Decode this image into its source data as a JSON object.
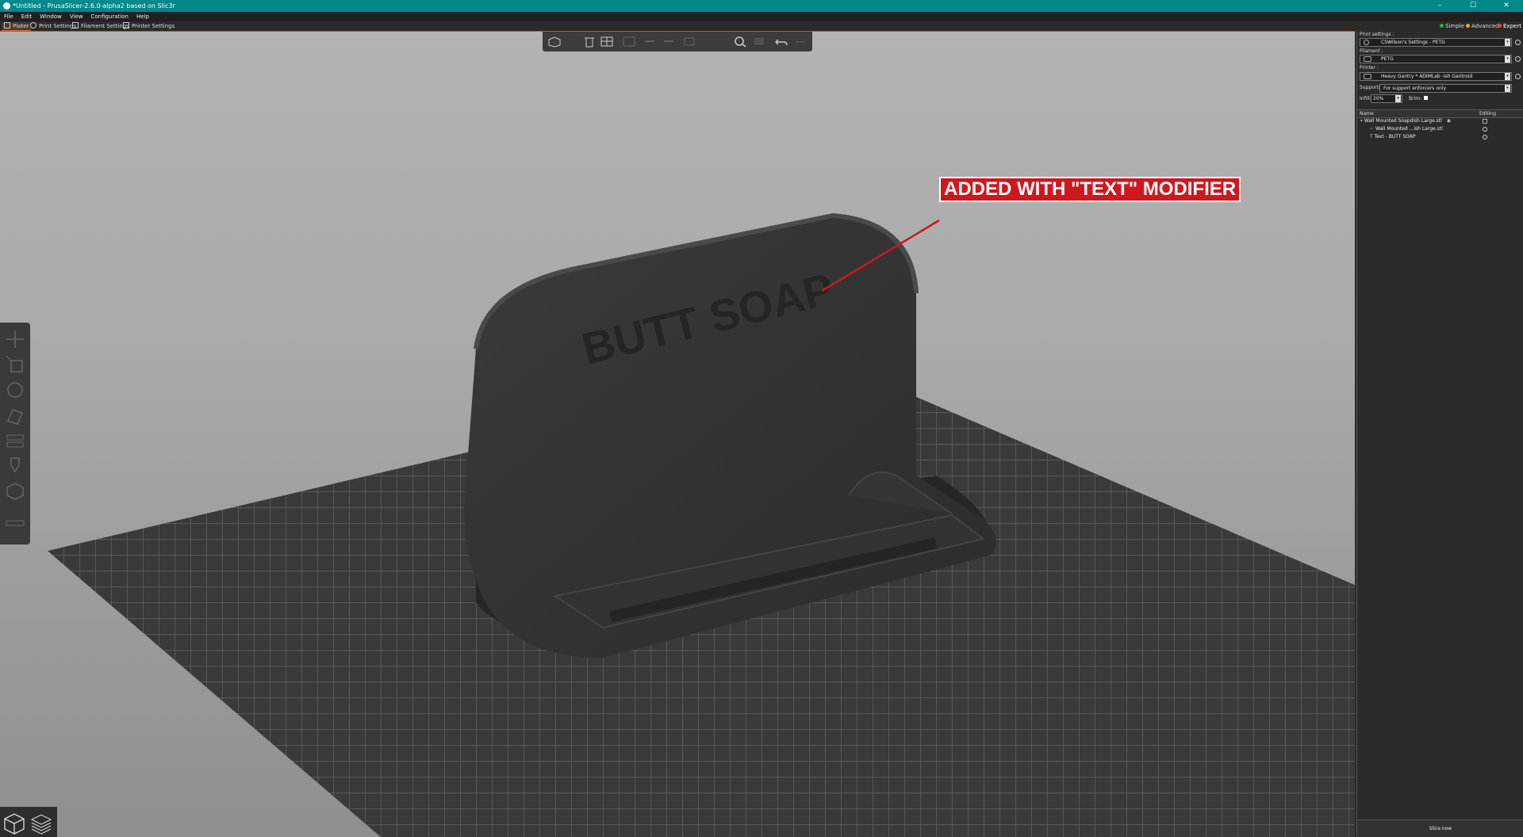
{
  "window": {
    "title": "*Untitled - PrusaSlicer-2.6.0-alpha2 based on Slic3r",
    "buttons": {
      "minimize": "–",
      "maximize": "☐",
      "close": "✕"
    }
  },
  "menu": [
    "File",
    "Edit",
    "Window",
    "View",
    "Configuration",
    "Help"
  ],
  "tabs": [
    {
      "label": "Plater",
      "active": true
    },
    {
      "label": "Print Settings",
      "active": false
    },
    {
      "label": "Filament Settings",
      "active": false
    },
    {
      "label": "Printer Settings",
      "active": false
    }
  ],
  "modes": {
    "simple": "Simple",
    "advanced": "Advanced",
    "expert": "Expert",
    "colors": {
      "simple": "#22b14c",
      "advanced": "#e8b400",
      "expert": "#e84a1f"
    }
  },
  "viewport": {
    "model_text": "BUTT SOAP",
    "callout": "ADDED WITH \"TEXT\" MODIFIER",
    "callout_color": "#d0161e"
  },
  "sidebar": {
    "print_settings_label": "Print settings :",
    "print_settings_value": "CSWilson's Settings - PETG",
    "filament_label": "Filament :",
    "filament_value": "PETG",
    "printer_label": "Printer :",
    "printer_value": "Heavy Gantry * ADIMLab -ish Gantroid",
    "supports_label": "Supports:",
    "supports_value": "For support enforcers only",
    "infill_label": "Infill:",
    "infill_value": "20%",
    "brim_label": "Brim:",
    "col_name": "Name",
    "col_editing": "Editing",
    "objects": [
      {
        "name": "Wall Mounted Soapdish Large.stl"
      },
      {
        "name": "Wall Mounted ...ish Large.stl"
      },
      {
        "name": "Text - BUTT SOAP"
      }
    ],
    "slice_label": "Slice now"
  }
}
